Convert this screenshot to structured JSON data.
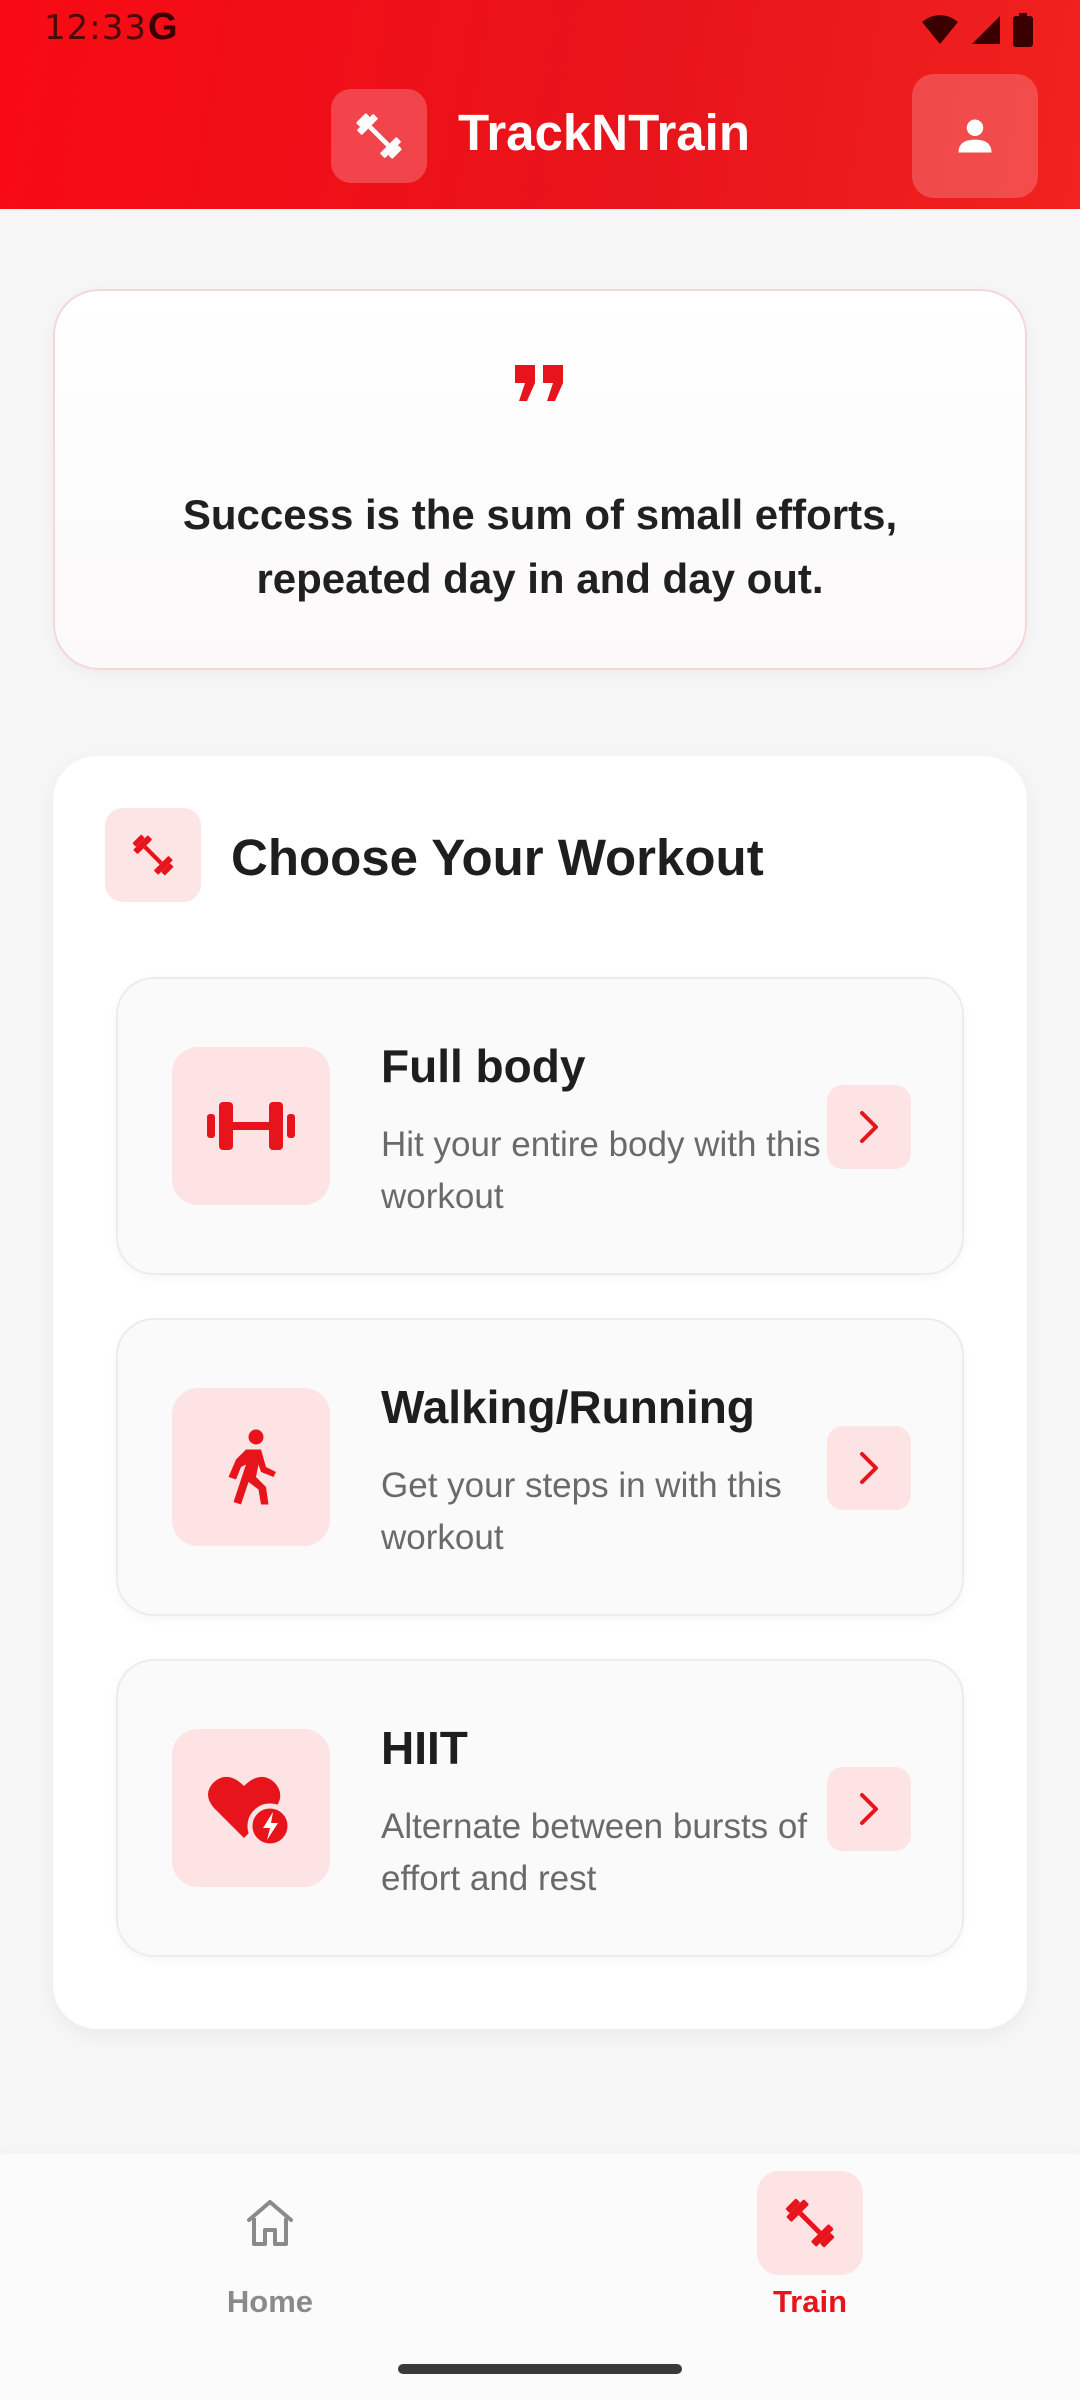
{
  "status_bar": {
    "time": "12:33",
    "google_badge": "G",
    "icons": [
      "wifi-icon",
      "signal-icon",
      "battery-icon"
    ]
  },
  "header": {
    "app_title": "TrackNTrain",
    "logo_icon": "dumbbell-icon",
    "profile_icon": "person-icon",
    "background_color": "#e8141b"
  },
  "quote": {
    "icon": "quote-icon",
    "text": "Success is the sum of small efforts, repeated day in and day out."
  },
  "workout_section": {
    "icon": "dumbbell-icon",
    "title": "Choose Your Workout",
    "workouts": [
      {
        "title": "Full body",
        "description": "Hit your entire body with this workout",
        "icon": "fitness-center-icon"
      },
      {
        "title": "Walking/Running",
        "description": "Get your steps in with this workout",
        "icon": "walking-person-icon"
      },
      {
        "title": "HIIT",
        "description": "Alternate between bursts of effort and rest",
        "icon": "heart-bolt-icon"
      }
    ]
  },
  "bottom_nav": {
    "items": [
      {
        "label": "Home",
        "icon": "home-icon",
        "active": false
      },
      {
        "label": "Train",
        "icon": "dumbbell-icon",
        "active": true
      }
    ]
  },
  "colors": {
    "accent": "#e8141b",
    "accent_light": "#fde3e4",
    "inactive": "#8a8a8a"
  }
}
